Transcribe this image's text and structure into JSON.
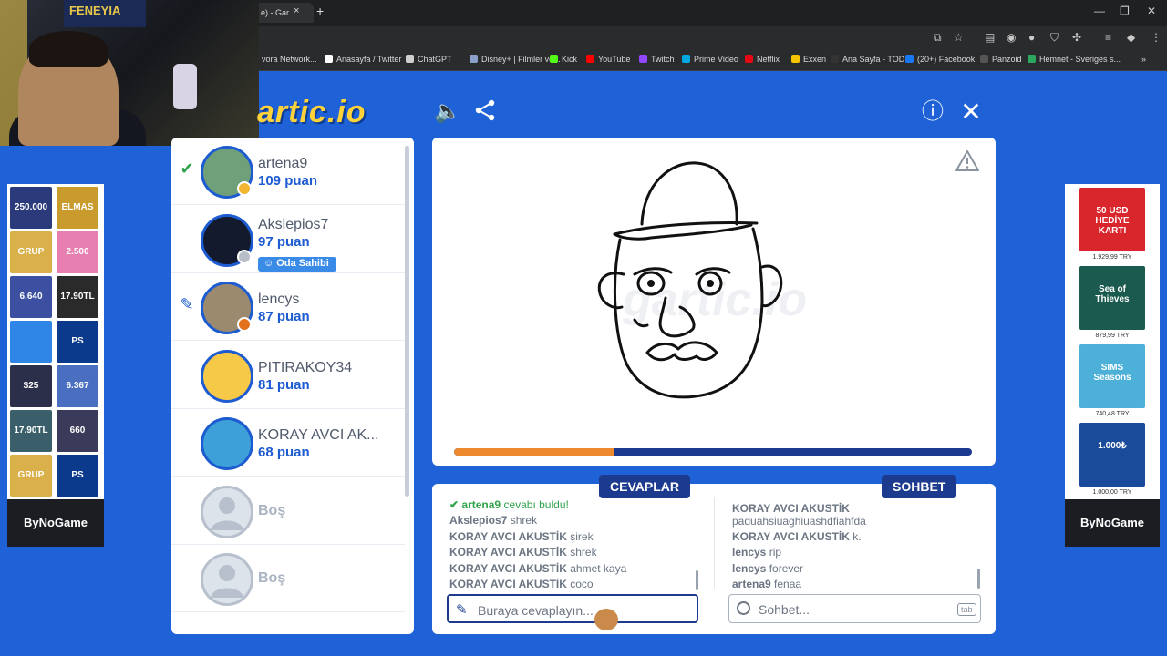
{
  "browser": {
    "tab_title": "e) - Gar",
    "tab_close": "×",
    "tab_new": "+",
    "window_controls": [
      "—",
      "❐",
      "✕"
    ],
    "bookmarks": [
      {
        "label": "vora Network...",
        "color": "#5a5a5a"
      },
      {
        "label": "Anasayfa / Twitter",
        "color": "#ffffff"
      },
      {
        "label": "ChatGPT",
        "color": "#cfcfcf"
      },
      {
        "label": "Disney+ | Filmler ve...",
        "color": "#8aa0c8"
      },
      {
        "label": "Kick",
        "color": "#53fc18"
      },
      {
        "label": "YouTube",
        "color": "#ff0000"
      },
      {
        "label": "Twitch",
        "color": "#9146ff"
      },
      {
        "label": "Prime Video",
        "color": "#00a8e1"
      },
      {
        "label": "Netflix",
        "color": "#e50914"
      },
      {
        "label": "Exxen",
        "color": "#f5c400"
      },
      {
        "label": "Ana Sayfa - TOD",
        "color": "#333333"
      },
      {
        "label": "(20+) Facebook",
        "color": "#1877f2"
      },
      {
        "label": "Panzoid",
        "color": "#555555"
      },
      {
        "label": "Hemnet - Sveriges s...",
        "color": "#2ca760"
      }
    ],
    "bookmarks_more": "»"
  },
  "webcam": {
    "flag_text": "FENEYIA"
  },
  "header": {
    "logo": "artic.io",
    "sound_icon": "🔈",
    "share_icon": "⋖",
    "info_icon": "ⓘ",
    "close_icon": "✕"
  },
  "players": [
    {
      "name": "artena9",
      "score": "109 puan",
      "mark": "✔",
      "mark_color": "#2fa24a",
      "avatar_color": "#6fa07a",
      "badge_color": "#f2b632"
    },
    {
      "name": "Akslepios7",
      "score": "97 puan",
      "role": "Oda Sahibi",
      "avatar_color": "#141a2e",
      "badge_color": "#b8bec8"
    },
    {
      "name": "lencys",
      "score": "87 puan",
      "mark": "✎",
      "mark_color": "#1d5bd0",
      "avatar_color": "#9c8a6e",
      "badge_color": "#e2701c"
    },
    {
      "name": "PITIRAKOY34",
      "score": "81 puan",
      "avatar_color": "#f7c948"
    },
    {
      "name": "KORAY AVCI AK...",
      "score": "68 puan",
      "avatar_color": "#3ea0d8"
    },
    {
      "empty": "Boş"
    },
    {
      "empty": "Boş"
    }
  ],
  "canvas": {
    "warning_icon": "⚠",
    "progress": 0.31,
    "watermark": "gartic.io"
  },
  "answers": {
    "tab": "CEVAPLAR",
    "messages": [
      {
        "user": "artena9",
        "text": "cevabı buldu!",
        "correct": true
      },
      {
        "user": "Akslepios7",
        "text": "shrek"
      },
      {
        "user": "KORAY AVCI AKUSTİK",
        "text": "şirek"
      },
      {
        "user": "KORAY AVCI AKUSTİK",
        "text": "shrek"
      },
      {
        "user": "KORAY AVCI AKUSTİK",
        "text": "ahmet kaya"
      },
      {
        "user": "KORAY AVCI AKUSTİK",
        "text": "coco"
      }
    ],
    "placeholder": "Buraya cevaplayın..."
  },
  "chat": {
    "tab": "SOHBET",
    "messages": [
      {
        "user": "KORAY AVCI AKUSTİK",
        "text": "paduahsiuaghiuashdfiahfda",
        "wrap": true
      },
      {
        "user": "KORAY AVCI AKUSTİK",
        "text": "k."
      },
      {
        "user": "lencys",
        "text": "rip"
      },
      {
        "user": "lencys",
        "text": "forever"
      },
      {
        "user": "artena9",
        "text": "fenaa"
      }
    ],
    "placeholder": "Sohbet...",
    "tab_key": "tab"
  },
  "ad_left": {
    "tiles": [
      {
        "label": "250.000",
        "color": "#2a3a7a"
      },
      {
        "label": "ELMAS",
        "color": "#c99a2c"
      },
      {
        "label": "GRUP",
        "color": "#d9b04a"
      },
      {
        "label": "2.500",
        "color": "#e77fb0"
      },
      {
        "label": "6.640",
        "color": "#3c4fa0"
      },
      {
        "label": "17.90TL",
        "color": "#2a2a2a"
      },
      {
        "label": "",
        "color": "#2f86e6"
      },
      {
        "label": "PS",
        "color": "#0b3a8c"
      },
      {
        "label": "$25",
        "color": "#2b2f4a"
      },
      {
        "label": "6.367",
        "color": "#4a6fc0"
      },
      {
        "label": "17.90TL",
        "color": "#3b5f6a"
      },
      {
        "label": "660",
        "color": "#3a3a5a"
      },
      {
        "label": "GRUP",
        "color": "#d9b04a"
      },
      {
        "label": "PS",
        "color": "#0b3a8c"
      }
    ],
    "footer": "ByNoGame"
  },
  "ad_right": {
    "products": [
      {
        "label": "50 USD HEDİYE KARTI",
        "price": "1.929,99 TRY",
        "color": "#d9262c"
      },
      {
        "label": "Sea of Thieves",
        "price": "879,99 TRY",
        "color": "#1b5a4e"
      },
      {
        "label": "SIMS Seasons",
        "price": "740,48 TRY",
        "color": "#4db0d8"
      },
      {
        "label": "1.000₺",
        "price": "1.000,00 TRY",
        "color": "#1a4b9a"
      }
    ],
    "footer": "ByNoGame"
  }
}
